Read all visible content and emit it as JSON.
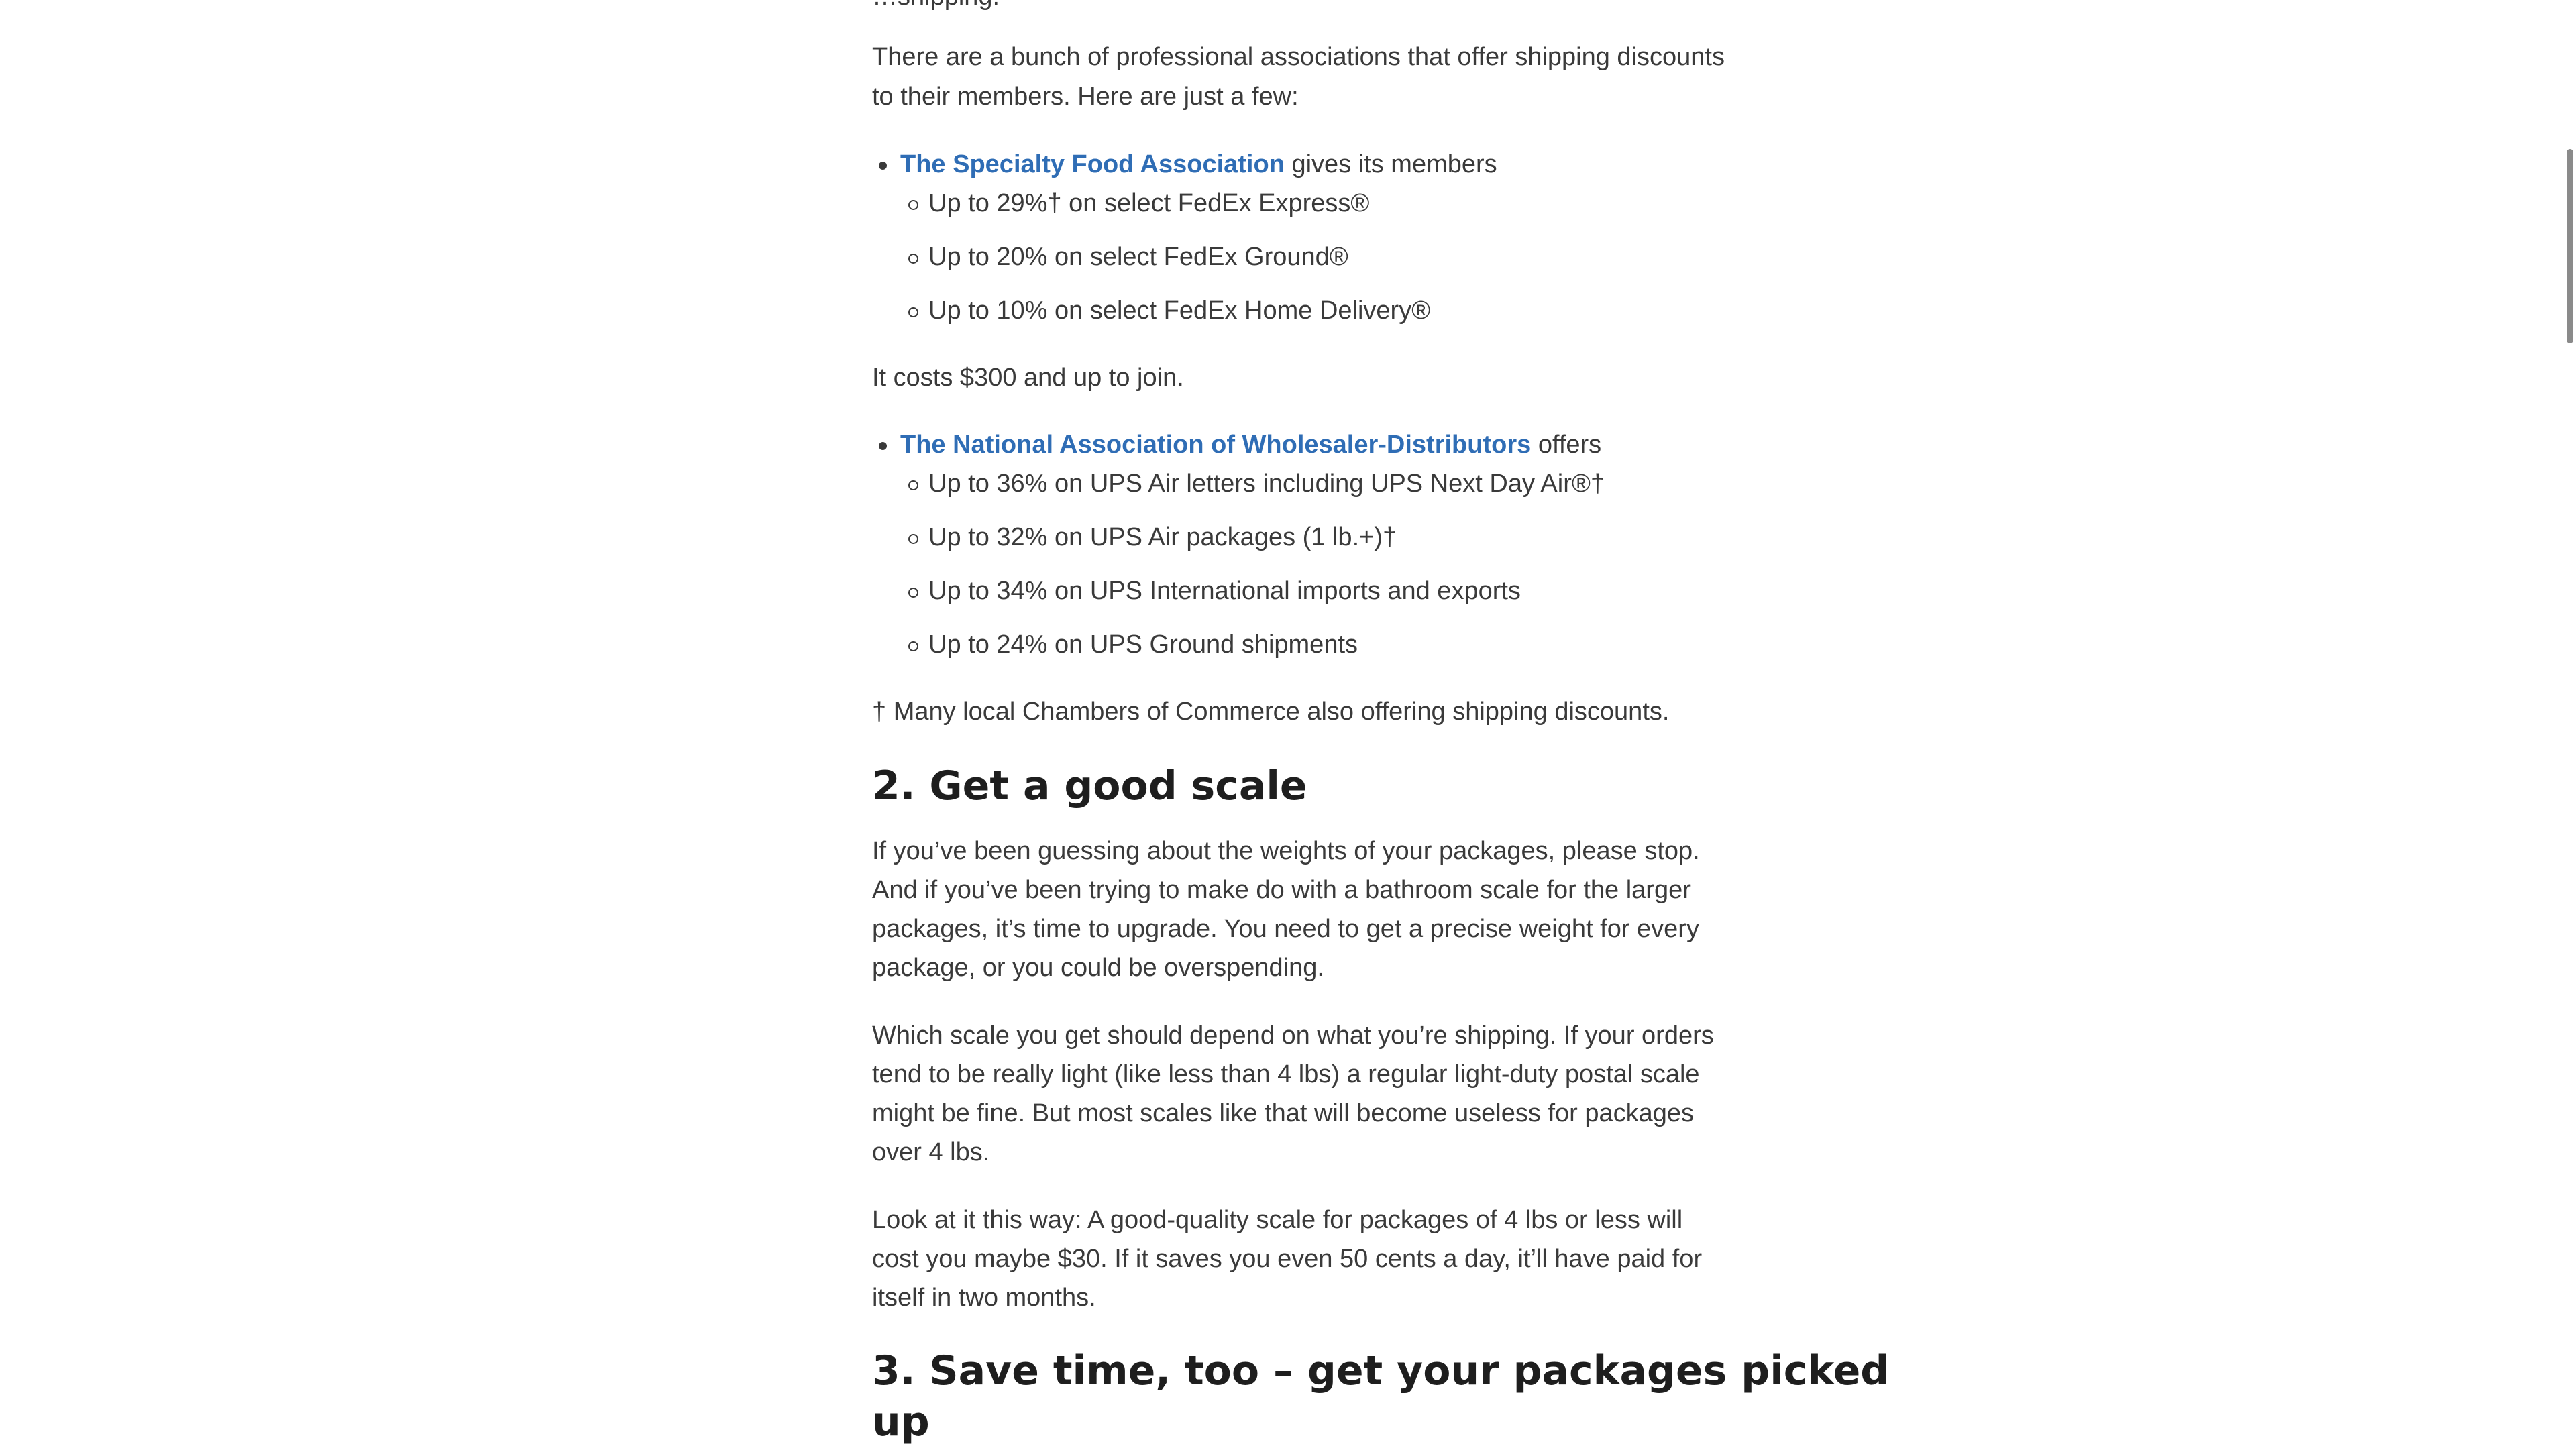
{
  "article": {
    "clipped_top_text": "…shipping.",
    "intro": {
      "line1": "There are a bunch of professional associations that offer shipping discounts",
      "line2": "to their members. Here are just a few:"
    },
    "sfa": {
      "link": "The Specialty Food Association",
      "rest": " gives its members",
      "items": [
        "Up to 29%† on select FedEx Express®",
        "Up to 20% on select FedEx Ground®",
        "Up to 10% on select FedEx Home Delivery®"
      ],
      "cost": "It costs $300 and up to join."
    },
    "nawd": {
      "link": "The National Association of Wholesaler-Distributors",
      "rest": " offers",
      "items": [
        "Up to 36% on UPS Air letters including UPS Next Day Air®†",
        "Up to 32% on UPS Air packages (1 lb.+)†",
        "Up to 34% on UPS International imports and exports",
        "Up to 24% on UPS Ground shipments"
      ]
    },
    "footnote": "† Many local Chambers of Commerce also offering shipping discounts.",
    "section2": {
      "heading": "2. Get a good scale",
      "p1": [
        "If you’ve been guessing about the weights of your packages, please stop.",
        "And if you’ve been trying to make do with a bathroom scale for the larger",
        "packages, it’s time to upgrade. You need to get a precise weight for every",
        "package, or you could be overspending."
      ],
      "p2": [
        "Which scale you get should depend on what you’re shipping. If your orders",
        "tend to be really light (like less than 4 lbs) a regular light-duty postal scale",
        "might be fine. But most scales like that will become useless for packages",
        "over 4 lbs."
      ],
      "p3": [
        "Look at it this way: A good-quality scale for packages of 4 lbs or less will",
        "cost you maybe $30. If it saves you even 50 cents a day, it’ll have paid for",
        "itself in two months."
      ]
    },
    "section3": {
      "heading_line1": "3. Save time, too – get your packages picked",
      "heading_line2": "up"
    }
  }
}
